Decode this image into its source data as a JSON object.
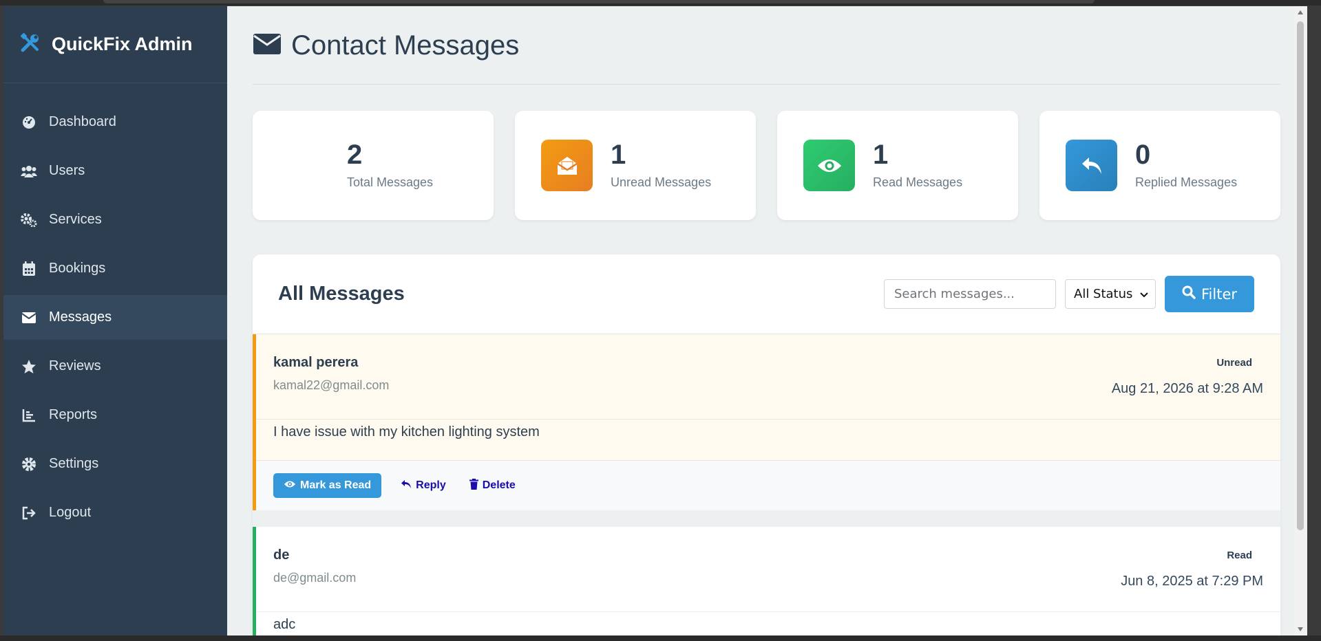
{
  "app": {
    "brand_title": "QuickFix Admin"
  },
  "sidebar": {
    "items": [
      {
        "label": "Dashboard",
        "icon": "dashboard-icon"
      },
      {
        "label": "Users",
        "icon": "users-icon"
      },
      {
        "label": "Services",
        "icon": "cogs-icon"
      },
      {
        "label": "Bookings",
        "icon": "calendar-icon"
      },
      {
        "label": "Messages",
        "icon": "envelope-icon",
        "active": true
      },
      {
        "label": "Reviews",
        "icon": "star-icon"
      },
      {
        "label": "Reports",
        "icon": "chart-icon"
      },
      {
        "label": "Settings",
        "icon": "gear-icon"
      },
      {
        "label": "Logout",
        "icon": "logout-icon"
      }
    ]
  },
  "page": {
    "title": "Contact Messages"
  },
  "stats": [
    {
      "value": "2",
      "label": "Total Messages"
    },
    {
      "value": "1",
      "label": "Unread Messages",
      "color": "#e67e22"
    },
    {
      "value": "1",
      "label": "Read Messages",
      "color": "#2ecc71"
    },
    {
      "value": "0",
      "label": "Replied Messages",
      "color": "#3498db"
    }
  ],
  "panel": {
    "title": "All Messages",
    "search_placeholder": "Search messages...",
    "status_select": "All Status",
    "filter_label": "Filter"
  },
  "messages": [
    {
      "name": "kamal perera",
      "email": "kamal22@gmail.com",
      "status": "Unread",
      "date": "Aug 21, 2026 at 9:28 AM",
      "body": "I have issue with my kitchen lighting system",
      "actions": {
        "mark": "Mark as Read",
        "reply": "Reply",
        "delete": "Delete"
      }
    },
    {
      "name": "de",
      "email": "de@gmail.com",
      "status": "Read",
      "date": "Jun 8, 2025 at 7:29 PM",
      "body": "adc"
    }
  ],
  "colors": {
    "sidebar": "#2c3e50",
    "accent": "#3498db",
    "unread": "#f39c12",
    "read": "#27ae60"
  }
}
